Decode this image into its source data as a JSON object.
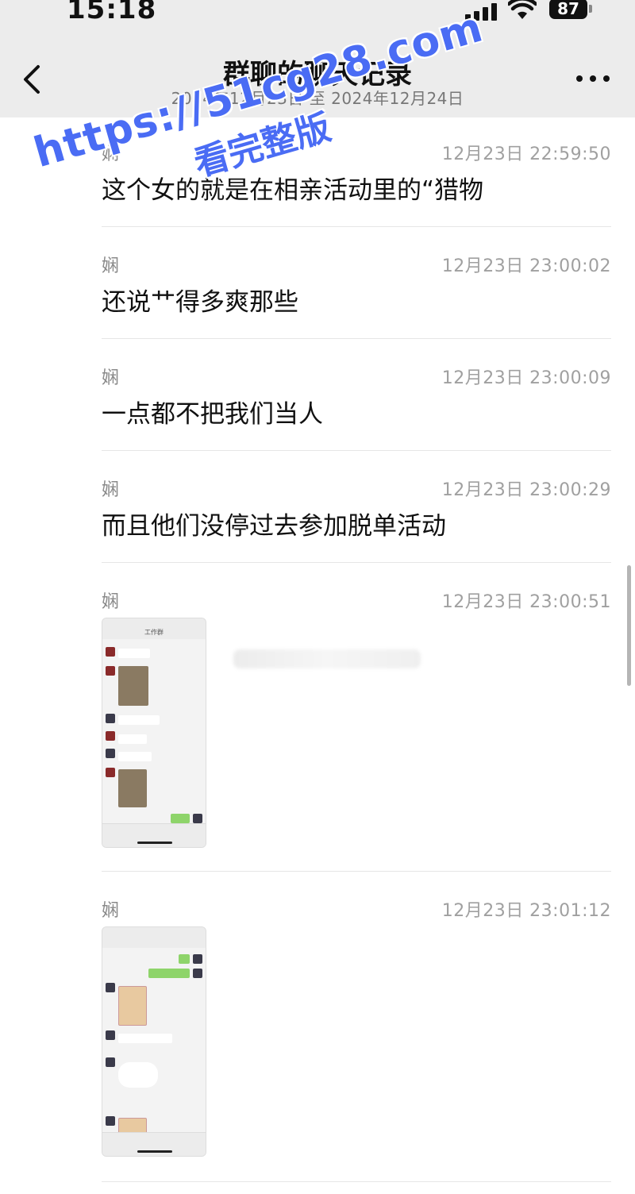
{
  "status_bar": {
    "time": "15:18",
    "battery": "87"
  },
  "nav": {
    "title": "群聊的聊天记录",
    "subtitle": "2024年12月23日 至 2024年12月24日"
  },
  "watermark": {
    "line1": "https://51cg28.com",
    "line2": "看完整版"
  },
  "messages": [
    {
      "sender": "娴",
      "time": "12月23日 22:59:50",
      "text": "这个女的就是在相亲活动里的“猎物"
    },
    {
      "sender": "娴",
      "time": "12月23日 23:00:02",
      "text": "还说艹得多爽那些"
    },
    {
      "sender": "娴",
      "time": "12月23日 23:00:09",
      "text": "一点都不把我们当人"
    },
    {
      "sender": "娴",
      "time": "12月23日 23:00:29",
      "text": "而且他们没停过去参加脱单活动"
    },
    {
      "sender": "娴",
      "time": "12月23日 23:00:51",
      "image_title": "工作群"
    },
    {
      "sender": "娴",
      "time": "12月23日 23:01:12",
      "image_title": ""
    }
  ],
  "colors": {
    "header_bg": "#ececec",
    "watermark": "#4a6cf4",
    "accent_green": "#8ed46a"
  },
  "icons": [
    "back-arrow-icon",
    "more-icon",
    "signal-icon",
    "wifi-icon",
    "battery-icon"
  ]
}
